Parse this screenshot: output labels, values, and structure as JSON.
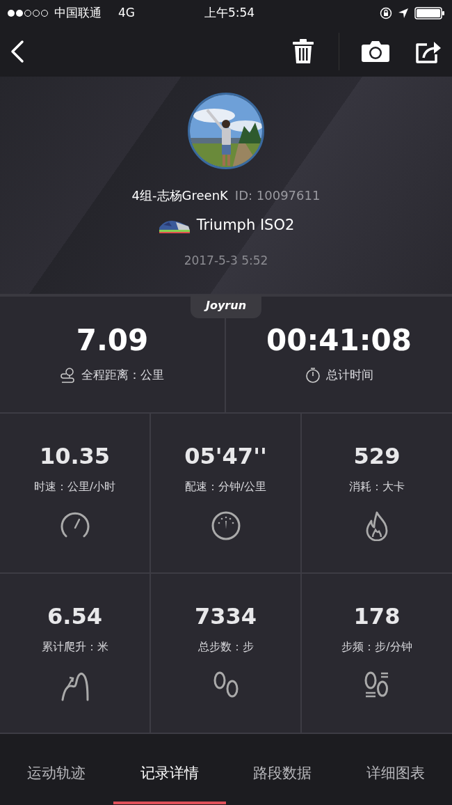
{
  "status_bar": {
    "carrier": "中国联通",
    "network": "4G",
    "time": "上午5:54"
  },
  "profile": {
    "name": "4组-志杨GreenK",
    "id": "ID: 10097611",
    "shoe": "Triumph ISO2",
    "date": "2017-5-3 5:52"
  },
  "brand": "Joyrun",
  "main_stats": [
    {
      "value": "7.09",
      "label": "全程距离：公里"
    },
    {
      "value": "00:41:08",
      "label": "总计时间"
    }
  ],
  "stats": [
    {
      "value": "10.35",
      "label": "时速：公里/小时"
    },
    {
      "value": "05'47''",
      "label": "配速：分钟/公里"
    },
    {
      "value": "529",
      "label": "消耗：大卡"
    },
    {
      "value": "6.54",
      "label": "累计爬升：米"
    },
    {
      "value": "7334",
      "label": "总步数：步"
    },
    {
      "value": "178",
      "label": "步频：步/分钟"
    }
  ],
  "tabs": [
    {
      "label": "运动轨迹",
      "selected": false
    },
    {
      "label": "记录详情",
      "selected": true
    },
    {
      "label": "路段数据",
      "selected": false
    },
    {
      "label": "详细图表",
      "selected": false
    }
  ]
}
